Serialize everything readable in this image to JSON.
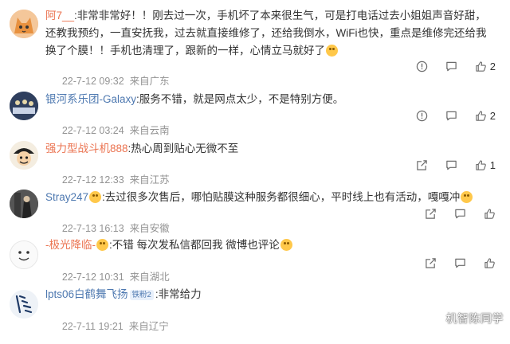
{
  "comments": [
    {
      "username": "阿7__",
      "text": ":非常非常好！！刚去过一次，手机坏了本来很生气，可是打电话过去小姐姐声音好甜，还教我预约，一直安抚我，过去就直接维修了，还给我倒水，WiFi也快，重点是维修完还给我换了个膜！！手机也清理了，跟新的一样，心情立马就好了",
      "time": "22-7-12 09:32",
      "location": "来自广东",
      "like_count": "2",
      "comment_count": ""
    },
    {
      "username": "银河系乐团-Galaxy",
      "text": ":服务不错，就是网点太少，不是特别方便。",
      "time": "22-7-12 03:24",
      "location": "来自云南",
      "like_count": "2",
      "comment_count": ""
    },
    {
      "username": "强力型战斗机888",
      "text": ":热心周到贴心无微不至",
      "time": "22-7-12 12:33",
      "location": "来自江苏",
      "like_count": "1",
      "comment_count": ""
    },
    {
      "username": "Stray247",
      "text": ":去过很多次售后，哪怕贴膜这种服务都很细心，平时线上也有活动，嘎嘎冲",
      "time": "22-7-13 16:13",
      "location": "来自安徽",
      "like_count": "",
      "comment_count": ""
    },
    {
      "username": "-极光降临-",
      "text": ":不错 每次发私信都回我 微博也评论",
      "time": "22-7-12 10:31",
      "location": "来自湖北",
      "like_count": "",
      "comment_count": ""
    },
    {
      "username": "lpts06白鹤舞飞扬",
      "badge": "铁粉2",
      "text": ":非常给力",
      "time": "22-7-11 19:21",
      "location": "来自辽宁",
      "like_count": "",
      "comment_count": ""
    }
  ],
  "watermark": "机智陈同学",
  "colors": {
    "username": "#eb7350",
    "text": "#333333",
    "meta": "#939393",
    "icon": "#6a6a6a"
  }
}
